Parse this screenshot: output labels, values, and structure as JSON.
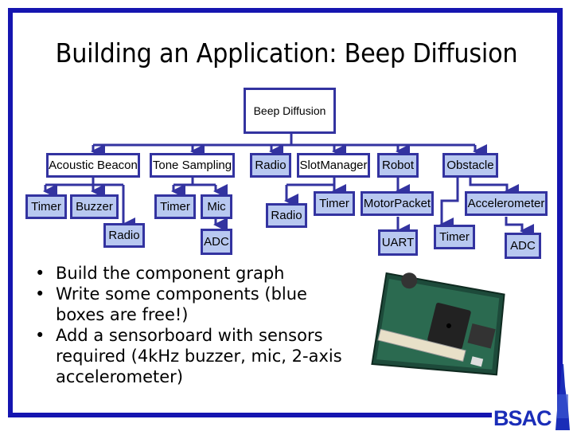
{
  "slide": {
    "title": "Building an Application: Beep Diffusion",
    "accent_color": "#1515b0",
    "node_fill_free": "#b8c8f0",
    "node_fill_write": "#ffffff"
  },
  "graph": {
    "root": "Beep Diffusion",
    "level1": [
      {
        "label": "Acoustic Beacon",
        "type": "write"
      },
      {
        "label": "Tone Sampling",
        "type": "write"
      },
      {
        "label": "Radio",
        "type": "free"
      },
      {
        "label": "SlotManager",
        "type": "write"
      },
      {
        "label": "Robot",
        "type": "free"
      },
      {
        "label": "Obstacle",
        "type": "free"
      }
    ],
    "level2": [
      {
        "label": "Timer",
        "parent": "Acoustic Beacon"
      },
      {
        "label": "Buzzer",
        "parent": "Acoustic Beacon"
      },
      {
        "label": "Radio",
        "parent": "Acoustic Beacon"
      },
      {
        "label": "Timer",
        "parent": "Tone Sampling"
      },
      {
        "label": "Mic",
        "parent": "Tone Sampling"
      },
      {
        "label": "ADC",
        "parent": "Mic"
      },
      {
        "label": "Radio",
        "parent": "SlotManager"
      },
      {
        "label": "Timer",
        "parent": "SlotManager"
      },
      {
        "label": "MotorPacket",
        "parent": "Robot"
      },
      {
        "label": "UART",
        "parent": "MotorPacket"
      },
      {
        "label": "Accelerometer",
        "parent": "Obstacle"
      },
      {
        "label": "Timer",
        "parent": "Obstacle"
      },
      {
        "label": "ADC",
        "parent": "Accelerometer"
      }
    ]
  },
  "bullets": [
    "Build the component graph",
    "Write some components (blue boxes are free!)",
    "Add a sensorboard with sensors required (4kHz buzzer, mic, 2-axis accelerometer)"
  ],
  "images": {
    "board": "sensorboard-photo",
    "logo": "BSAC"
  }
}
